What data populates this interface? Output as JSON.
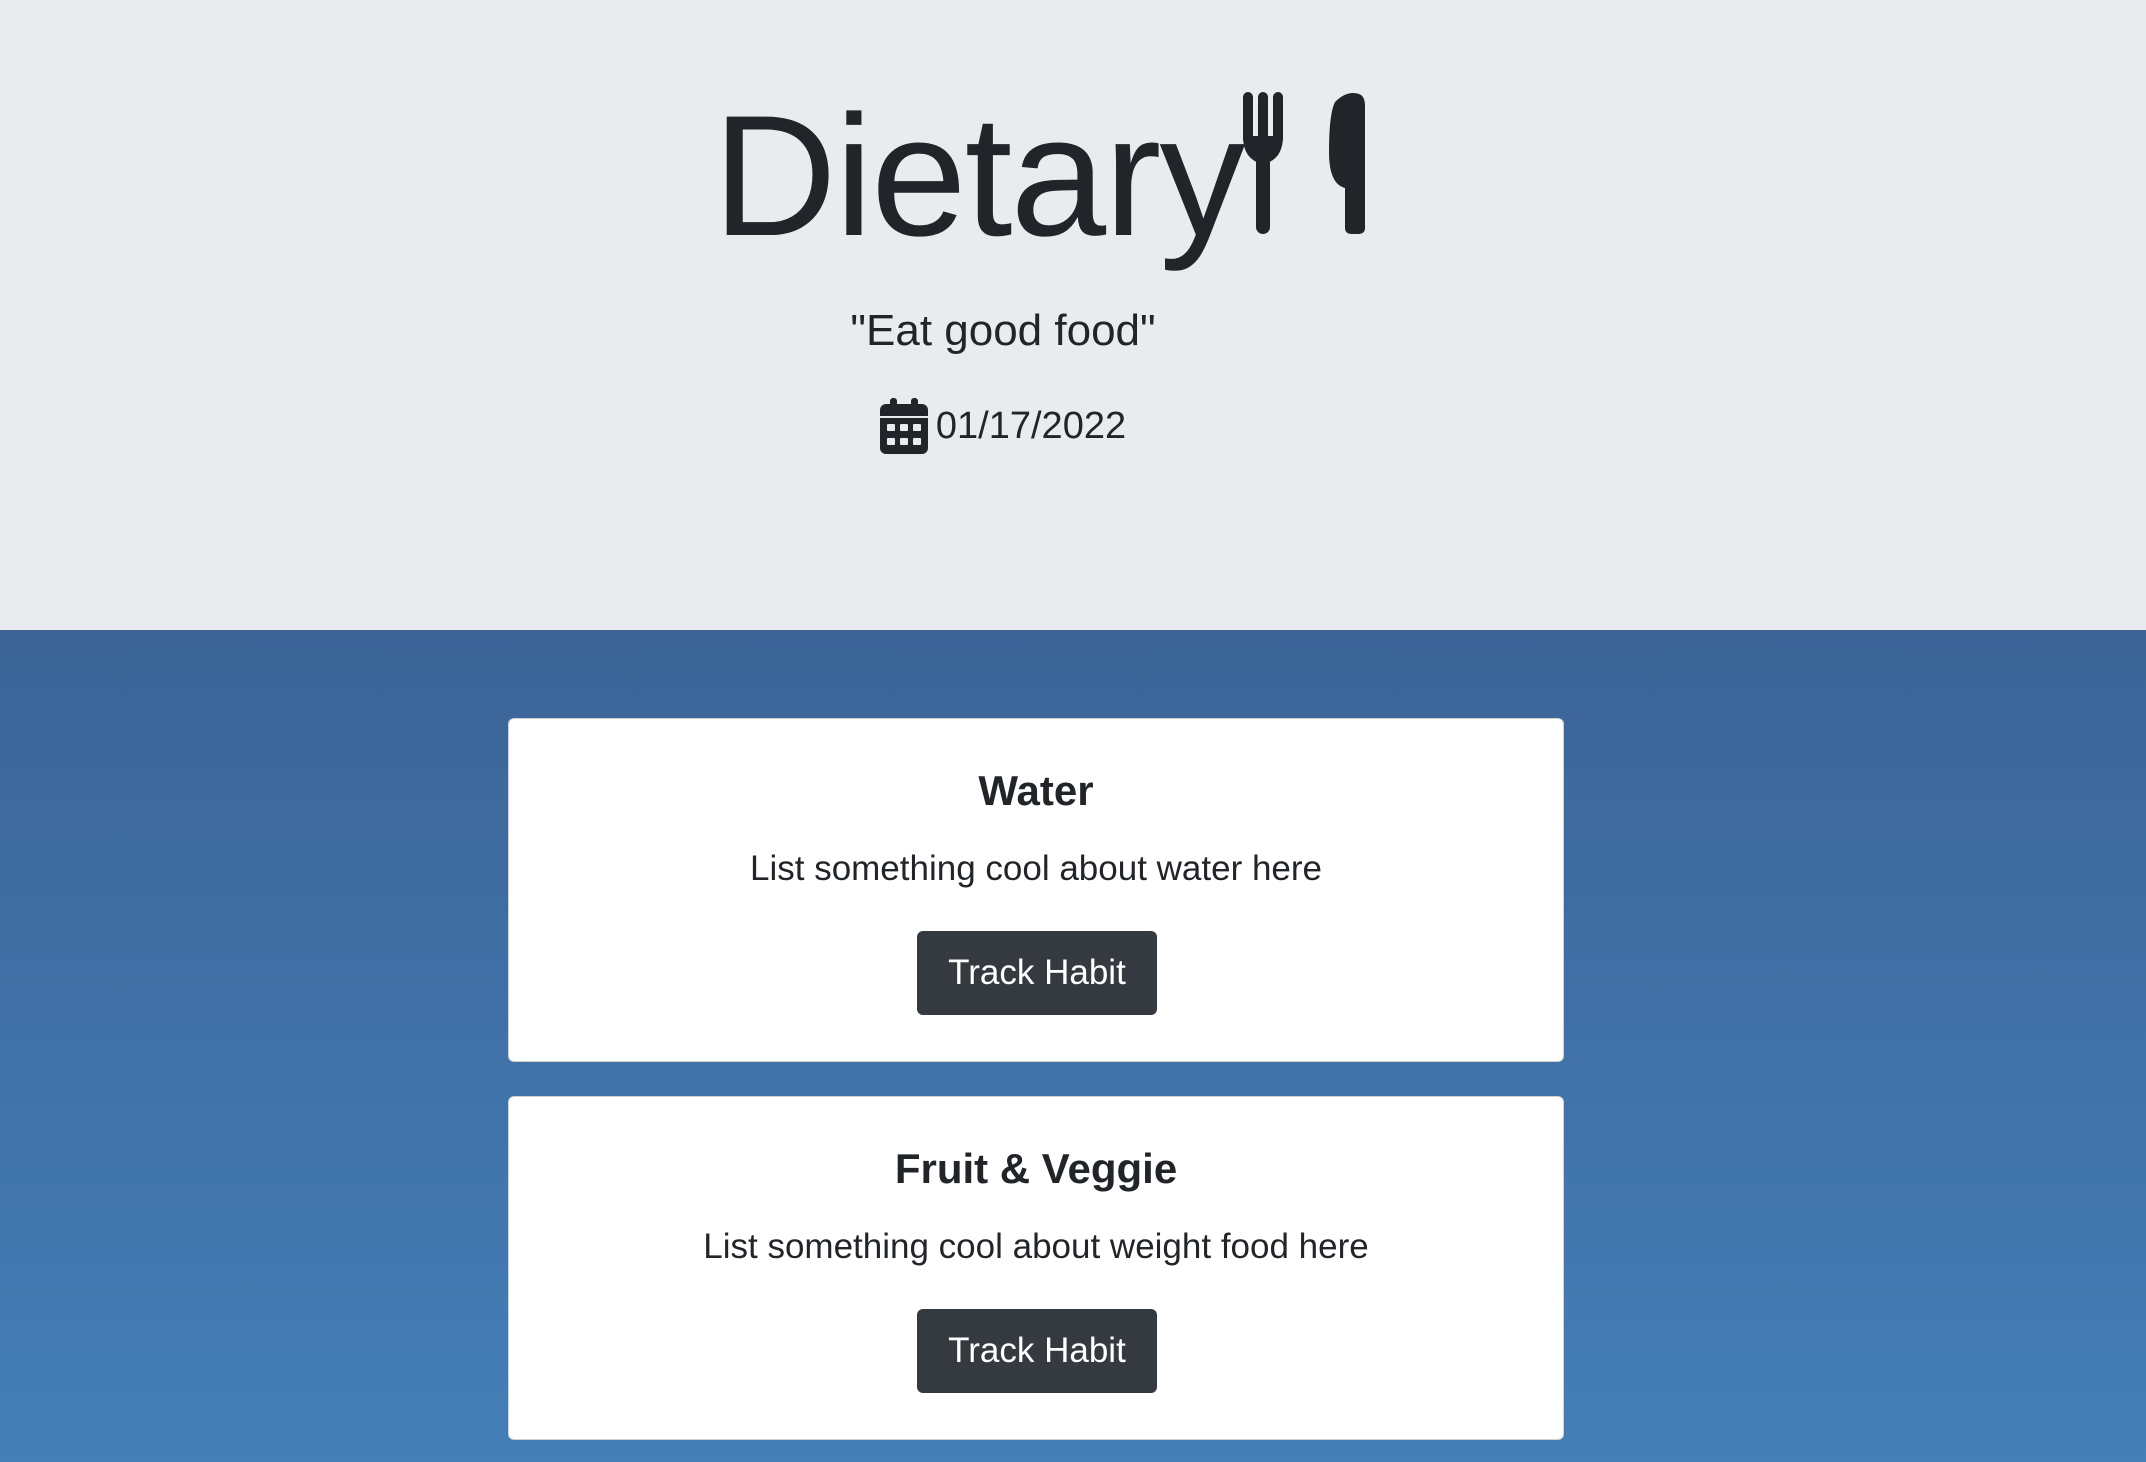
{
  "header": {
    "title": "Dietary",
    "title_icon": "utensils-icon",
    "slogan": "\"Eat good food\"",
    "date_icon": "calendar-icon",
    "date": "01/17/2022"
  },
  "cards": [
    {
      "title": "Water",
      "text": "List something cool about water here",
      "button_label": "Track Habit"
    },
    {
      "title": "Fruit & Veggie",
      "text": "List something cool about weight food here",
      "button_label": "Track Habit"
    }
  ],
  "colors": {
    "header_bg": "#e9ebef",
    "main_bg_top": "#3c6497",
    "main_bg_bottom": "#447fb7",
    "button_bg": "#343a40",
    "text": "#212529"
  }
}
